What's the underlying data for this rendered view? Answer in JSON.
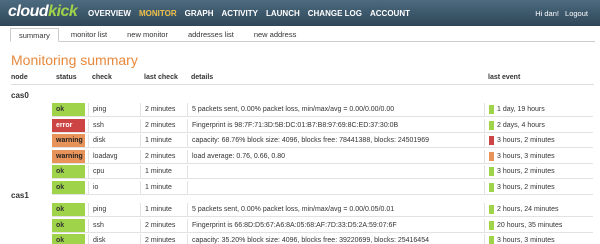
{
  "app": {
    "logo_main": "cloud",
    "logo_accent": "kick"
  },
  "nav": [
    "OVERVIEW",
    "MONITOR",
    "GRAPH",
    "ACTIVITY",
    "LAUNCH",
    "CHANGE LOG",
    "ACCOUNT"
  ],
  "nav_active": "MONITOR",
  "user": {
    "greeting": "Hi dan!",
    "logout": "Logout"
  },
  "subnav": [
    "summary",
    "monitor list",
    "new monitor",
    "addresses list",
    "new address"
  ],
  "page_title": "Monitoring summary",
  "columns": {
    "node": "node",
    "status": "status",
    "check": "check",
    "last_check": "last check",
    "details": "details",
    "last_event": "last event"
  },
  "colors": {
    "ok": "#9ed34a",
    "error": "#cc4444",
    "warning": "#e8935a",
    "title": "#e8883c"
  },
  "groups": [
    {
      "node": "cas0",
      "rows": [
        {
          "status": "ok",
          "check": "ping",
          "last_check": "2 minutes",
          "details": "5 packets sent, 0.00% packet loss, min/max/avg = 0.00/0.00/0.00",
          "last_event": "1 day, 19 hours",
          "event_color": "#9ed34a"
        },
        {
          "status": "error",
          "check": "ssh",
          "last_check": "2 minutes",
          "details": "Fingerprint is 98:7F:71:3D:5B:DC:01:B7:B8:97:69:8C:ED:37:30:0B",
          "last_event": "2 days, 4 hours",
          "event_color": "#9ed34a"
        },
        {
          "status": "warning",
          "check": "disk",
          "last_check": "1 minute",
          "details": "capacity: 68.76% block size: 4096, blocks free: 78441388, blocks: 24501969",
          "last_event": "3 hours, 2 minutes",
          "event_color": "#cc4444"
        },
        {
          "status": "warning",
          "check": "loadavg",
          "last_check": "2 minutes",
          "details": "load average: 0.76, 0.66, 0.80",
          "last_event": "3 hours, 3 minutes",
          "event_color": "#e8935a"
        },
        {
          "status": "ok",
          "check": "cpu",
          "last_check": "1 minute",
          "details": "",
          "last_event": "3 hours, 2 minutes",
          "event_color": "#9ed34a"
        },
        {
          "status": "ok",
          "check": "io",
          "last_check": "1 minute",
          "details": "",
          "last_event": "3 hours, 2 minutes",
          "event_color": "#9ed34a"
        }
      ]
    },
    {
      "node": "cas1",
      "rows": [
        {
          "status": "ok",
          "check": "ping",
          "last_check": "1 minute",
          "details": "5 packets sent, 0.00% packet loss, min/max/avg = 0.00/0.05/0.01",
          "last_event": "2 hours, 24 minutes",
          "event_color": "#9ed34a"
        },
        {
          "status": "ok",
          "check": "ssh",
          "last_check": "2 minutes",
          "details": "Fingerprint is 66:8D:D5:67:A6:8A:05:68:AF:7D:33:D5:2A:59:07:6F",
          "last_event": "20 hours, 35 minutes",
          "event_color": "#9ed34a"
        },
        {
          "status": "ok",
          "check": "disk",
          "last_check": "2 minutes",
          "details": "capacity: 35.20% block size: 4096, blocks free: 39220699, blocks: 25416454",
          "last_event": "3 hours, 3 minutes",
          "event_color": "#9ed34a"
        }
      ]
    }
  ]
}
